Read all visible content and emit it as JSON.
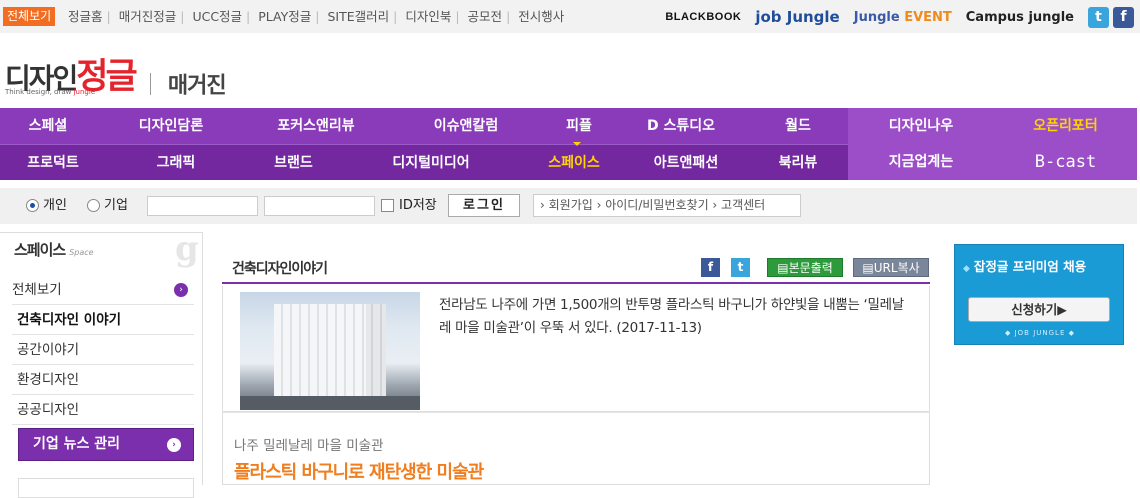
{
  "topbar": {
    "all_label": "전체보기",
    "links": [
      "정글홈",
      "매거진정글",
      "UCC정글",
      "PLAY정글",
      "SITE갤러리",
      "디자인북",
      "공모전",
      "전시행사"
    ],
    "brands": {
      "blackbook": "BLACKBOOK",
      "jobjungle": "job Jungle",
      "event_a": "Jungle ",
      "event_b": "EVENT",
      "campus": "Campus jungle"
    }
  },
  "logo": {
    "main_a": "디자인",
    "main_b": "정글",
    "tagline_a": "Think design, draw ",
    "tagline_b": "jungle",
    "magazine": "매거진"
  },
  "nav": {
    "row1": [
      "스페셜",
      "디자인담론",
      "포커스앤리뷰",
      "이슈앤칼럼",
      "피플",
      "D 스튜디오",
      "월드",
      "디자인나우",
      "오픈리포터"
    ],
    "row2": [
      "프로덕트",
      "그래픽",
      "브랜드",
      "디지털미디어",
      "스페이스",
      "아트앤패션",
      "북리뷰",
      "지금업계는",
      "B-cast"
    ],
    "active": "스페이스"
  },
  "login": {
    "radio_personal": "개인",
    "radio_company": "기업",
    "save_id": "ID저장",
    "login_button": "로그인",
    "links": "› 회원가입  › 아이디/비밀번호찾기  › 고객센터"
  },
  "sidebar": {
    "title": "스페이스",
    "title_en": "Space",
    "bg_letter": "g",
    "items": [
      "전체보기",
      "건축디자인 이야기",
      "공간이야기",
      "환경디자인",
      "공공디자인"
    ],
    "active_index": 1,
    "news_button": "기업 뉴스 관리"
  },
  "content": {
    "section_title": "건축디자인이야기",
    "print_label": "본문출력",
    "url_label": "URL복사",
    "article1": "전라남도 나주에 가면 1,500개의 반투명 플라스틱 바구니가 하얀빛을 내뿜는 ‘밀레날레 마을 미술관’이 우뚝 서 있다. (2017-11-13)",
    "article2_sub": "나주 밀레날레 마을 미술관",
    "article2_headline": "플라스틱 바구니로 재탄생한 미술관"
  },
  "ad": {
    "title": "잡정글 프리미엄 채용",
    "button": "신청하기▶",
    "footer": "◆ JOB JUNGLE ◆"
  }
}
